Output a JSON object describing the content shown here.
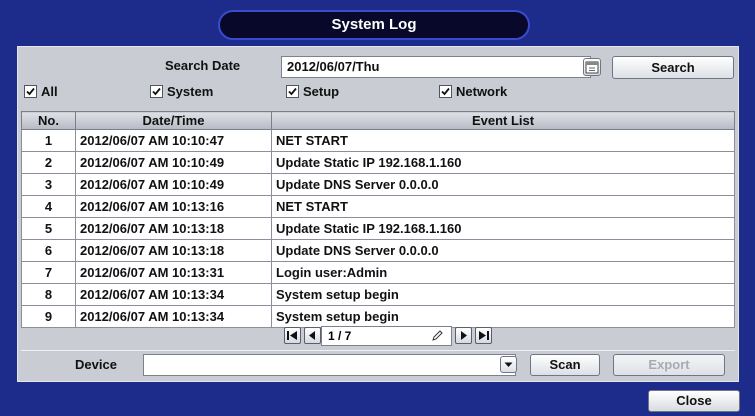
{
  "window": {
    "title": "System Log"
  },
  "search": {
    "date_label": "Search Date",
    "date_value": "2012/06/07/Thu",
    "search_label": "Search"
  },
  "filters": [
    {
      "label": "All",
      "checked": true
    },
    {
      "label": "System",
      "checked": true
    },
    {
      "label": "Setup",
      "checked": true
    },
    {
      "label": "Network",
      "checked": true
    }
  ],
  "table": {
    "headers": [
      "No.",
      "Date/Time",
      "Event List"
    ],
    "rows": [
      {
        "no": "1",
        "datetime": "2012/06/07 AM 10:10:47",
        "event": "NET START"
      },
      {
        "no": "2",
        "datetime": "2012/06/07 AM 10:10:49",
        "event": "Update Static IP 192.168.1.160"
      },
      {
        "no": "3",
        "datetime": "2012/06/07 AM 10:10:49",
        "event": "Update DNS Server 0.0.0.0"
      },
      {
        "no": "4",
        "datetime": "2012/06/07 AM 10:13:16",
        "event": "NET START"
      },
      {
        "no": "5",
        "datetime": "2012/06/07 AM 10:13:18",
        "event": "Update Static IP 192.168.1.160"
      },
      {
        "no": "6",
        "datetime": "2012/06/07 AM 10:13:18",
        "event": "Update DNS Server 0.0.0.0"
      },
      {
        "no": "7",
        "datetime": "2012/06/07 AM 10:13:31",
        "event": "Login user:Admin"
      },
      {
        "no": "8",
        "datetime": "2012/06/07 AM 10:13:34",
        "event": "System setup begin"
      },
      {
        "no": "9",
        "datetime": "2012/06/07 AM 10:13:34",
        "event": "System setup begin"
      }
    ]
  },
  "pagination": {
    "page": "1 / 7"
  },
  "device": {
    "label": "Device",
    "value": "",
    "scan_label": "Scan",
    "export_label": "Export"
  },
  "footer": {
    "close_label": "Close"
  },
  "colors": {
    "background": "#1d2b8a",
    "panel": "#c9ccd3",
    "title_pill": "#07082a"
  },
  "icons": [
    "calendar-icon",
    "checkmark-icon",
    "first-page-icon",
    "prev-page-icon",
    "edit-page-icon",
    "next-page-icon",
    "last-page-icon",
    "dropdown-arrow-icon"
  ]
}
